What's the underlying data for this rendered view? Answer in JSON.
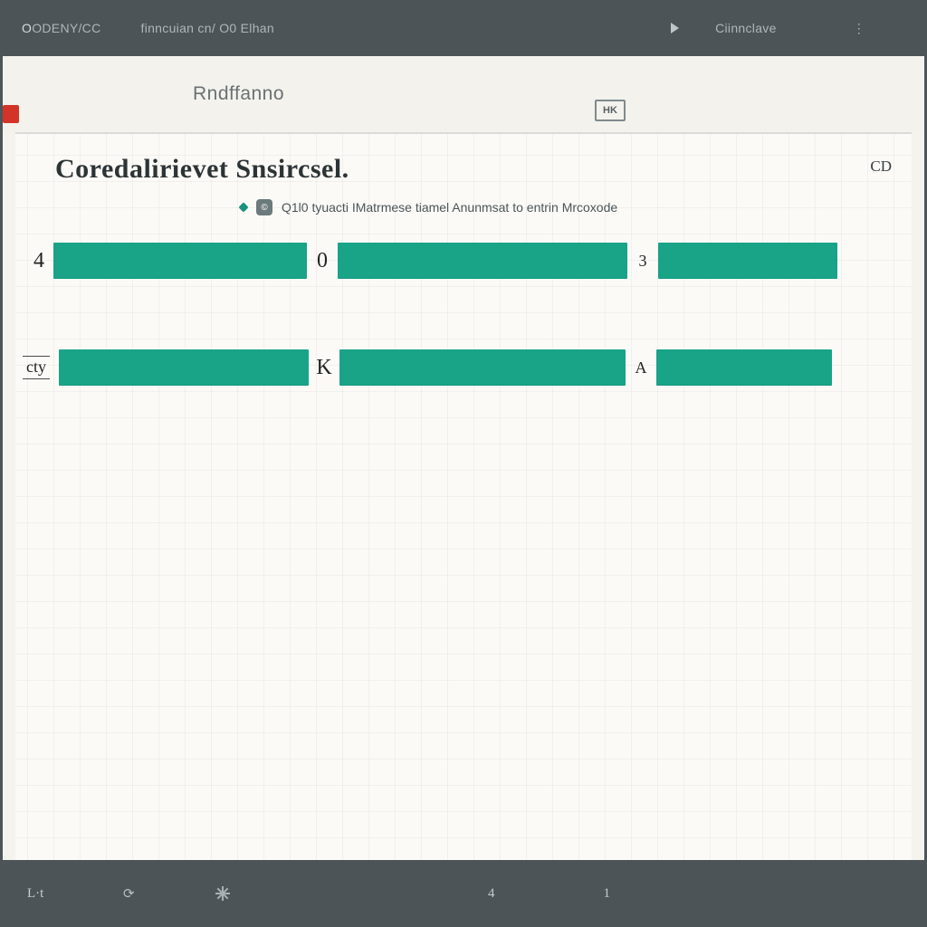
{
  "menubar": {
    "items": [
      "ODENY/CC",
      "finncuian  cn/ O0  Elhan",
      "Ciinnclave"
    ],
    "hint_icon": "play-icon"
  },
  "subheader": {
    "title": "Rndffanno",
    "badge": "HK"
  },
  "panel": {
    "title": "Coredalirievet Snsircsel.",
    "corner_code": "CD",
    "desc_leading_badge": "©",
    "desc_text": "Q1l0   tyuacti IMatrmese tiamel  Anunmsat to  entrin  Mrcoxode",
    "row1": {
      "label": "4",
      "mid_label": "0",
      "end_label": "3"
    },
    "row2": {
      "label": "cty",
      "mid_label": "K",
      "end_label": "A"
    }
  },
  "bottombar": {
    "left_label": "L·t",
    "value_a": "4",
    "value_b": "1"
  },
  "colors": {
    "bar": "#19a387",
    "chrome": "#4c5458",
    "accent_red": "#d33428"
  }
}
